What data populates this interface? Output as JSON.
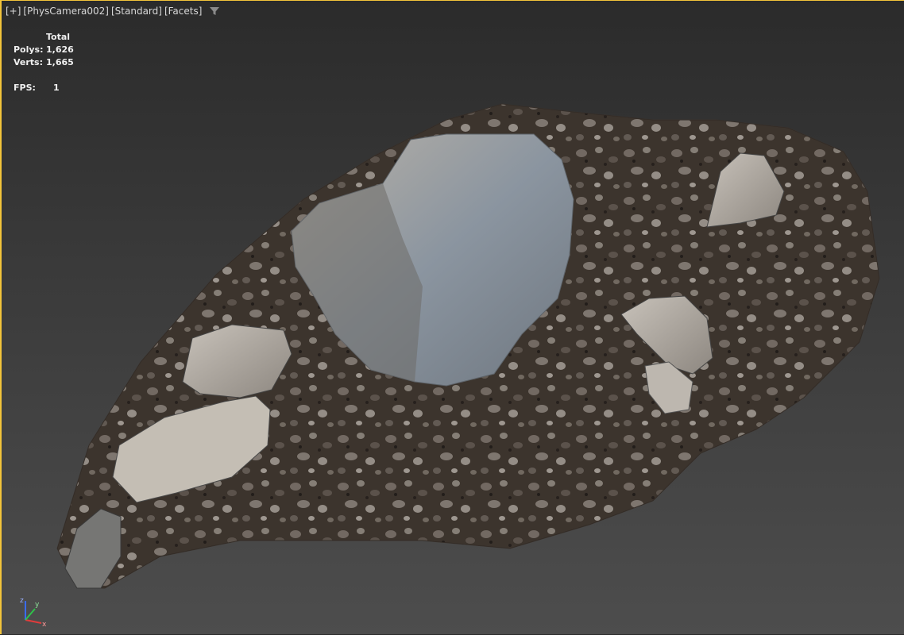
{
  "viewport": {
    "labels": [
      "[+]",
      "[PhysCamera002]",
      "[Standard]",
      "[Facets]"
    ],
    "filter_icon": "filter-icon"
  },
  "stats": {
    "total_label": "Total",
    "polys_label": "Polys:",
    "polys_value": "1,626",
    "verts_label": "Verts:",
    "verts_value": "1,665",
    "fps_label": "FPS:",
    "fps_value": "1"
  },
  "gizmo": {
    "x_label": "x",
    "y_label": "y",
    "z_label": "z",
    "colors": {
      "x": "#e23b3b",
      "y": "#2fc24a",
      "z": "#3a6bff"
    }
  },
  "colors": {
    "active_border": "#f3c43a"
  }
}
